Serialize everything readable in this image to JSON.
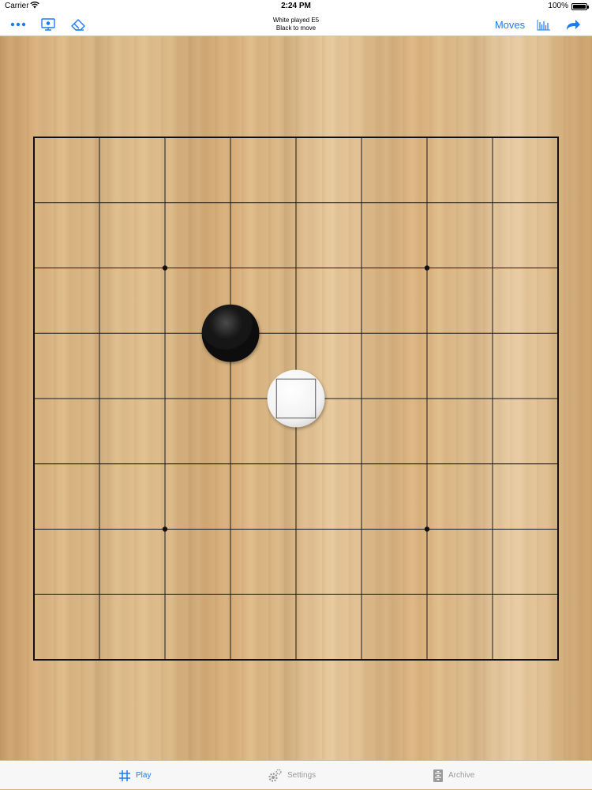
{
  "status_bar": {
    "carrier": "Carrier",
    "time": "2:24 PM",
    "battery": "100%"
  },
  "toolbar": {
    "status_line1": "White played E5",
    "status_line2": "Black to move",
    "moves_label": "Moves",
    "accent_color": "#1a7cf5",
    "icons": [
      "more-icon",
      "computer-play-icon",
      "eraser-icon",
      "graph-icon",
      "forward-arrow-icon"
    ]
  },
  "board": {
    "size": 9,
    "star_points": [
      "C3",
      "G3",
      "C7",
      "G7"
    ],
    "stones": [
      {
        "color": "black",
        "point": "D6"
      },
      {
        "color": "white",
        "point": "E5",
        "last_move": true
      }
    ]
  },
  "tabs": [
    {
      "label": "Play",
      "icon": "grid-icon",
      "active": true
    },
    {
      "label": "Settings",
      "icon": "gear-icon",
      "active": false
    },
    {
      "label": "Archive",
      "icon": "archive-icon",
      "active": false
    }
  ]
}
